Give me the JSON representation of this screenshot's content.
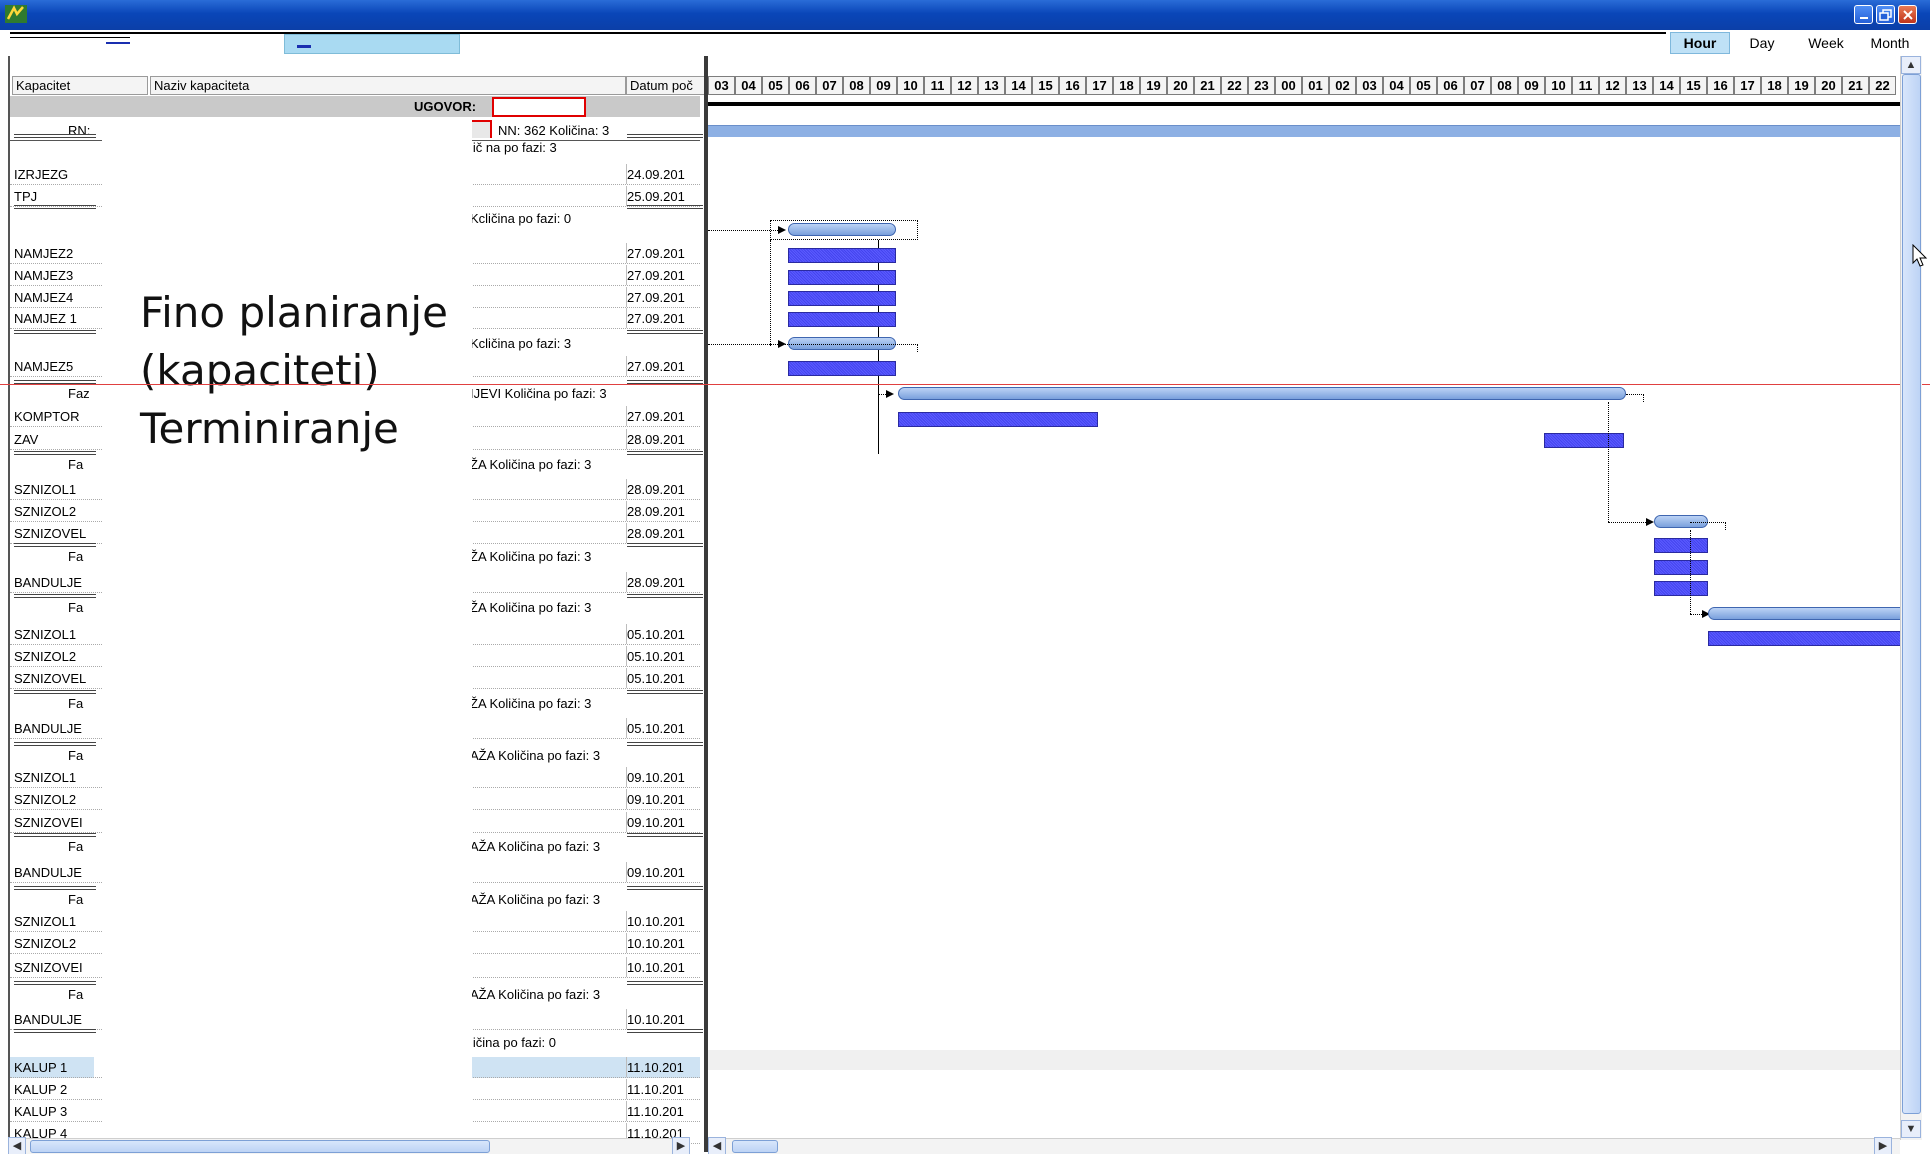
{
  "window": {
    "title": "",
    "app_icon": "app-logo-icon",
    "controls": [
      "minimize-icon",
      "restore-icon",
      "close-icon"
    ]
  },
  "toolbar": {
    "scales": [
      {
        "label": "Hour",
        "active": true
      },
      {
        "label": "Day",
        "active": false
      },
      {
        "label": "Week",
        "active": false
      },
      {
        "label": "Month",
        "active": false
      }
    ]
  },
  "left": {
    "headers": {
      "kapacitet": "Kapacitet",
      "naziv": "Naziv kapaciteta",
      "datum": "Datum poč"
    },
    "ugovor_label": "UGOVOR:",
    "rn_label": "RN:",
    "nn_text": "NN: 362  Količina: 3",
    "overlay": [
      "Fino planiranje",
      "(kapaciteti)",
      "Terminiranje"
    ],
    "rows": [
      {
        "kind": "phase",
        "left": "",
        "text": "lič na po fazi: 3"
      },
      {
        "kind": "cap",
        "name": "IZRJEZG",
        "date": "24.09.201"
      },
      {
        "kind": "cap",
        "name": "TPJ",
        "date": "25.09.201"
      },
      {
        "kind": "phase",
        "left": "",
        "text": "Kcličina po fazi: 0"
      },
      {
        "kind": "cap",
        "name": "NAMJEZ2",
        "date": "27.09.201"
      },
      {
        "kind": "cap",
        "name": "NAMJEZ3",
        "date": "27.09.201"
      },
      {
        "kind": "cap",
        "name": "NAMJEZ4",
        "date": "27.09.201"
      },
      {
        "kind": "cap",
        "name": "NAMJEZ 1",
        "date": "27.09.201"
      },
      {
        "kind": "phase",
        "left": "",
        "text": "Kcličina po fazi: 3"
      },
      {
        "kind": "cap",
        "name": "NAMJEZ5",
        "date": "27.09.201"
      },
      {
        "kind": "phase",
        "left": "Faz",
        "text": "IJEVI  Količina po fazi: 3"
      },
      {
        "kind": "cap",
        "name": "KOMPTOR",
        "date": "27.09.201"
      },
      {
        "kind": "cap",
        "name": "ZAV",
        "date": "28.09.201"
      },
      {
        "kind": "phase",
        "left": "Fa",
        "text": "ŽA  Količina po fazi: 3"
      },
      {
        "kind": "cap",
        "name": "SZNIZOL1",
        "date": "28.09.201"
      },
      {
        "kind": "cap",
        "name": "SZNIZOL2",
        "date": "28.09.201"
      },
      {
        "kind": "cap",
        "name": "SZNIZOVEL",
        "date": "28.09.201"
      },
      {
        "kind": "phase",
        "left": "Fa",
        "text": "ŽA  Količina po fazi: 3"
      },
      {
        "kind": "cap",
        "name": "BANDULJE",
        "date": "28.09.201"
      },
      {
        "kind": "phase",
        "left": "Fa",
        "text": "ŽA  Količina po fazi: 3"
      },
      {
        "kind": "cap",
        "name": "SZNIZOL1",
        "date": "05.10.201"
      },
      {
        "kind": "cap",
        "name": "SZNIZOL2",
        "date": "05.10.201"
      },
      {
        "kind": "cap",
        "name": "SZNIZOVEL",
        "date": "05.10.201"
      },
      {
        "kind": "phase",
        "left": "Fa",
        "text": "ŽA  Količina po fazi: 3"
      },
      {
        "kind": "cap",
        "name": "BANDULJE",
        "date": "05.10.201"
      },
      {
        "kind": "phase",
        "left": "Fa",
        "text": "AŽA  Količina po fazi: 3"
      },
      {
        "kind": "cap",
        "name": "SZNIZOL1",
        "date": "09.10.201"
      },
      {
        "kind": "cap",
        "name": "SZNIZOL2",
        "date": "09.10.201"
      },
      {
        "kind": "cap",
        "name": "SZNIZOVEI",
        "date": "09.10.201"
      },
      {
        "kind": "phase",
        "left": "Fa",
        "text": "AŽA  Količina po fazi: 3"
      },
      {
        "kind": "cap",
        "name": "BANDULJE",
        "date": "09.10.201"
      },
      {
        "kind": "phase",
        "left": "Fa",
        "text": "AŽA  Količina po fazi: 3"
      },
      {
        "kind": "cap",
        "name": "SZNIZOL1",
        "date": "10.10.201"
      },
      {
        "kind": "cap",
        "name": "SZNIZOL2",
        "date": "10.10.201"
      },
      {
        "kind": "cap",
        "name": "SZNIZOVEI",
        "date": "10.10.201"
      },
      {
        "kind": "phase",
        "left": "Fa",
        "text": "AŽA  Količina po fazi: 3"
      },
      {
        "kind": "cap",
        "name": "BANDULJE",
        "date": "10.10.201"
      },
      {
        "kind": "phase",
        "left": "",
        "text": "ličina po fazi: 0"
      },
      {
        "kind": "cap",
        "name": "KALUP 1",
        "date": "11.10.201",
        "selected": true
      },
      {
        "kind": "cap",
        "name": "KALUP 2",
        "date": "11.10.201"
      },
      {
        "kind": "cap",
        "name": "KALUP 3",
        "date": "11.10.201"
      },
      {
        "kind": "cap",
        "name": "KALUP 4",
        "date": "11.10.201"
      }
    ]
  },
  "gantt": {
    "hours": [
      "03",
      "04",
      "05",
      "06",
      "07",
      "08",
      "09",
      "10",
      "11",
      "12",
      "13",
      "14",
      "15",
      "16",
      "17",
      "18",
      "19",
      "20",
      "21",
      "22",
      "23",
      "00",
      "01",
      "02",
      "03",
      "04",
      "05",
      "06",
      "07",
      "08",
      "09",
      "10",
      "11",
      "12",
      "13",
      "14",
      "15",
      "16",
      "17",
      "18",
      "19",
      "20",
      "21",
      "22"
    ],
    "colors": {
      "task": "#4b4bf0",
      "summary": "#8fb0e6",
      "today_line": "#e04040"
    }
  }
}
